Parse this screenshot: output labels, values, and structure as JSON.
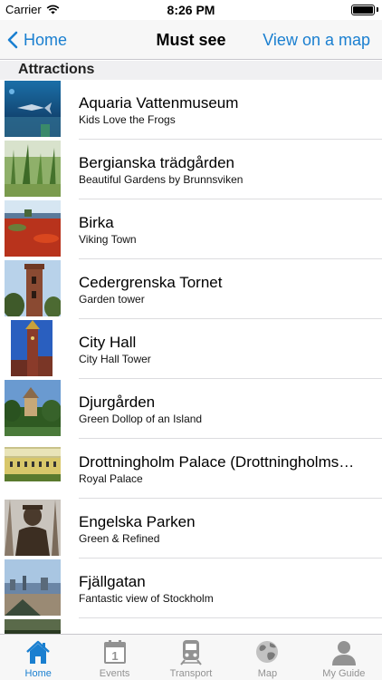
{
  "status_bar": {
    "carrier": "Carrier",
    "time": "8:26 PM"
  },
  "nav": {
    "back_label": "Home",
    "title": "Must see",
    "right_label": "View on a map"
  },
  "section": {
    "title": "Attractions"
  },
  "attractions": [
    {
      "title": "Aquaria Vattenmuseum",
      "subtitle": "Kids Love the Frogs"
    },
    {
      "title": "Bergianska trädgården",
      "subtitle": "Beautiful Gardens by Brunnsviken"
    },
    {
      "title": "Birka",
      "subtitle": "Viking Town"
    },
    {
      "title": "Cedergrenska Tornet",
      "subtitle": "Garden tower"
    },
    {
      "title": "City Hall",
      "subtitle": "City Hall Tower"
    },
    {
      "title": "Djurgården",
      "subtitle": "Green Dollop of an Island"
    },
    {
      "title": "Drottningholm Palace (Drottningholms…",
      "subtitle": "Royal Palace"
    },
    {
      "title": "Engelska Parken",
      "subtitle": "Green & Refined"
    },
    {
      "title": "Fjällgatan",
      "subtitle": "Fantastic view of Stockholm"
    },
    {
      "title": "",
      "subtitle": ""
    }
  ],
  "tabs": [
    {
      "label": "Home",
      "icon": "house-icon",
      "active": true
    },
    {
      "label": "Events",
      "icon": "calendar-icon",
      "active": false
    },
    {
      "label": "Transport",
      "icon": "train-icon",
      "active": false
    },
    {
      "label": "Map",
      "icon": "globe-icon",
      "active": false
    },
    {
      "label": "My Guide",
      "icon": "person-icon",
      "active": false
    }
  ],
  "colors": {
    "accent": "#1a7fd0",
    "tab_inactive": "#929292"
  }
}
